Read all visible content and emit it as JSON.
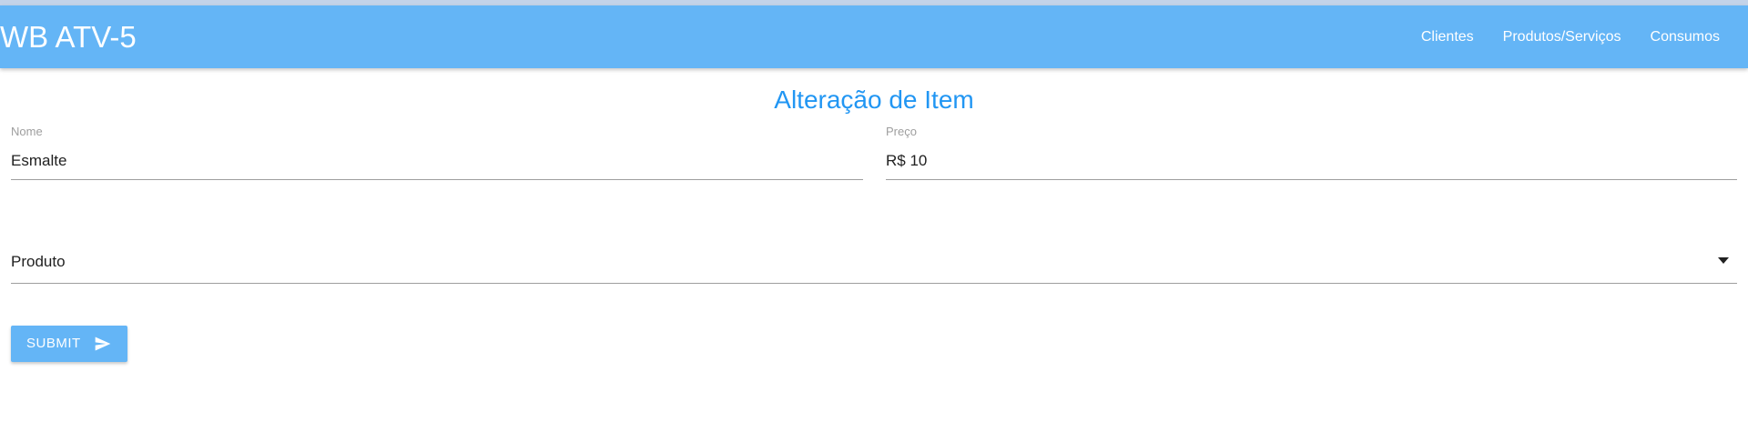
{
  "navbar": {
    "brand": "WB ATV-5",
    "links": [
      "Clientes",
      "Produtos/Serviços",
      "Consumos"
    ],
    "bg_color": "#64b5f6"
  },
  "form": {
    "title": "Alteração de Item",
    "nome": {
      "label": "Nome",
      "value": "Esmalte"
    },
    "preco": {
      "label": "Preço",
      "value": "R$ 10"
    },
    "tipo": {
      "selected": "Produto"
    },
    "submit": {
      "label": "SUBMIT",
      "icon": "send-icon"
    }
  },
  "colors": {
    "accent": "#2196f3",
    "button": "#64b5f6"
  }
}
